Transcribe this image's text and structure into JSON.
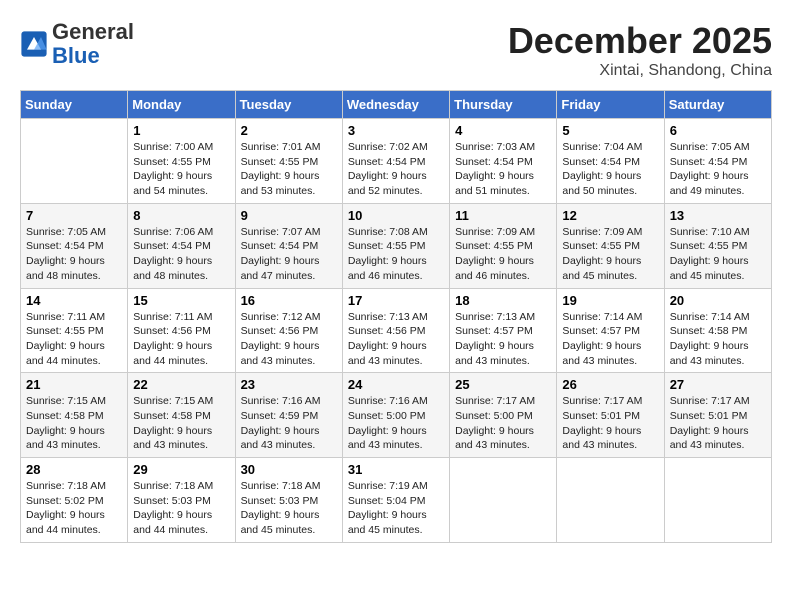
{
  "header": {
    "logo_general": "General",
    "logo_blue": "Blue",
    "month": "December 2025",
    "location": "Xintai, Shandong, China"
  },
  "days_of_week": [
    "Sunday",
    "Monday",
    "Tuesday",
    "Wednesday",
    "Thursday",
    "Friday",
    "Saturday"
  ],
  "weeks": [
    [
      {
        "num": "",
        "info": ""
      },
      {
        "num": "1",
        "info": "Sunrise: 7:00 AM\nSunset: 4:55 PM\nDaylight: 9 hours\nand 54 minutes."
      },
      {
        "num": "2",
        "info": "Sunrise: 7:01 AM\nSunset: 4:55 PM\nDaylight: 9 hours\nand 53 minutes."
      },
      {
        "num": "3",
        "info": "Sunrise: 7:02 AM\nSunset: 4:54 PM\nDaylight: 9 hours\nand 52 minutes."
      },
      {
        "num": "4",
        "info": "Sunrise: 7:03 AM\nSunset: 4:54 PM\nDaylight: 9 hours\nand 51 minutes."
      },
      {
        "num": "5",
        "info": "Sunrise: 7:04 AM\nSunset: 4:54 PM\nDaylight: 9 hours\nand 50 minutes."
      },
      {
        "num": "6",
        "info": "Sunrise: 7:05 AM\nSunset: 4:54 PM\nDaylight: 9 hours\nand 49 minutes."
      }
    ],
    [
      {
        "num": "7",
        "info": "Sunrise: 7:05 AM\nSunset: 4:54 PM\nDaylight: 9 hours\nand 48 minutes."
      },
      {
        "num": "8",
        "info": "Sunrise: 7:06 AM\nSunset: 4:54 PM\nDaylight: 9 hours\nand 48 minutes."
      },
      {
        "num": "9",
        "info": "Sunrise: 7:07 AM\nSunset: 4:54 PM\nDaylight: 9 hours\nand 47 minutes."
      },
      {
        "num": "10",
        "info": "Sunrise: 7:08 AM\nSunset: 4:55 PM\nDaylight: 9 hours\nand 46 minutes."
      },
      {
        "num": "11",
        "info": "Sunrise: 7:09 AM\nSunset: 4:55 PM\nDaylight: 9 hours\nand 46 minutes."
      },
      {
        "num": "12",
        "info": "Sunrise: 7:09 AM\nSunset: 4:55 PM\nDaylight: 9 hours\nand 45 minutes."
      },
      {
        "num": "13",
        "info": "Sunrise: 7:10 AM\nSunset: 4:55 PM\nDaylight: 9 hours\nand 45 minutes."
      }
    ],
    [
      {
        "num": "14",
        "info": "Sunrise: 7:11 AM\nSunset: 4:55 PM\nDaylight: 9 hours\nand 44 minutes."
      },
      {
        "num": "15",
        "info": "Sunrise: 7:11 AM\nSunset: 4:56 PM\nDaylight: 9 hours\nand 44 minutes."
      },
      {
        "num": "16",
        "info": "Sunrise: 7:12 AM\nSunset: 4:56 PM\nDaylight: 9 hours\nand 43 minutes."
      },
      {
        "num": "17",
        "info": "Sunrise: 7:13 AM\nSunset: 4:56 PM\nDaylight: 9 hours\nand 43 minutes."
      },
      {
        "num": "18",
        "info": "Sunrise: 7:13 AM\nSunset: 4:57 PM\nDaylight: 9 hours\nand 43 minutes."
      },
      {
        "num": "19",
        "info": "Sunrise: 7:14 AM\nSunset: 4:57 PM\nDaylight: 9 hours\nand 43 minutes."
      },
      {
        "num": "20",
        "info": "Sunrise: 7:14 AM\nSunset: 4:58 PM\nDaylight: 9 hours\nand 43 minutes."
      }
    ],
    [
      {
        "num": "21",
        "info": "Sunrise: 7:15 AM\nSunset: 4:58 PM\nDaylight: 9 hours\nand 43 minutes."
      },
      {
        "num": "22",
        "info": "Sunrise: 7:15 AM\nSunset: 4:58 PM\nDaylight: 9 hours\nand 43 minutes."
      },
      {
        "num": "23",
        "info": "Sunrise: 7:16 AM\nSunset: 4:59 PM\nDaylight: 9 hours\nand 43 minutes."
      },
      {
        "num": "24",
        "info": "Sunrise: 7:16 AM\nSunset: 5:00 PM\nDaylight: 9 hours\nand 43 minutes."
      },
      {
        "num": "25",
        "info": "Sunrise: 7:17 AM\nSunset: 5:00 PM\nDaylight: 9 hours\nand 43 minutes."
      },
      {
        "num": "26",
        "info": "Sunrise: 7:17 AM\nSunset: 5:01 PM\nDaylight: 9 hours\nand 43 minutes."
      },
      {
        "num": "27",
        "info": "Sunrise: 7:17 AM\nSunset: 5:01 PM\nDaylight: 9 hours\nand 43 minutes."
      }
    ],
    [
      {
        "num": "28",
        "info": "Sunrise: 7:18 AM\nSunset: 5:02 PM\nDaylight: 9 hours\nand 44 minutes."
      },
      {
        "num": "29",
        "info": "Sunrise: 7:18 AM\nSunset: 5:03 PM\nDaylight: 9 hours\nand 44 minutes."
      },
      {
        "num": "30",
        "info": "Sunrise: 7:18 AM\nSunset: 5:03 PM\nDaylight: 9 hours\nand 45 minutes."
      },
      {
        "num": "31",
        "info": "Sunrise: 7:19 AM\nSunset: 5:04 PM\nDaylight: 9 hours\nand 45 minutes."
      },
      {
        "num": "",
        "info": ""
      },
      {
        "num": "",
        "info": ""
      },
      {
        "num": "",
        "info": ""
      }
    ]
  ]
}
